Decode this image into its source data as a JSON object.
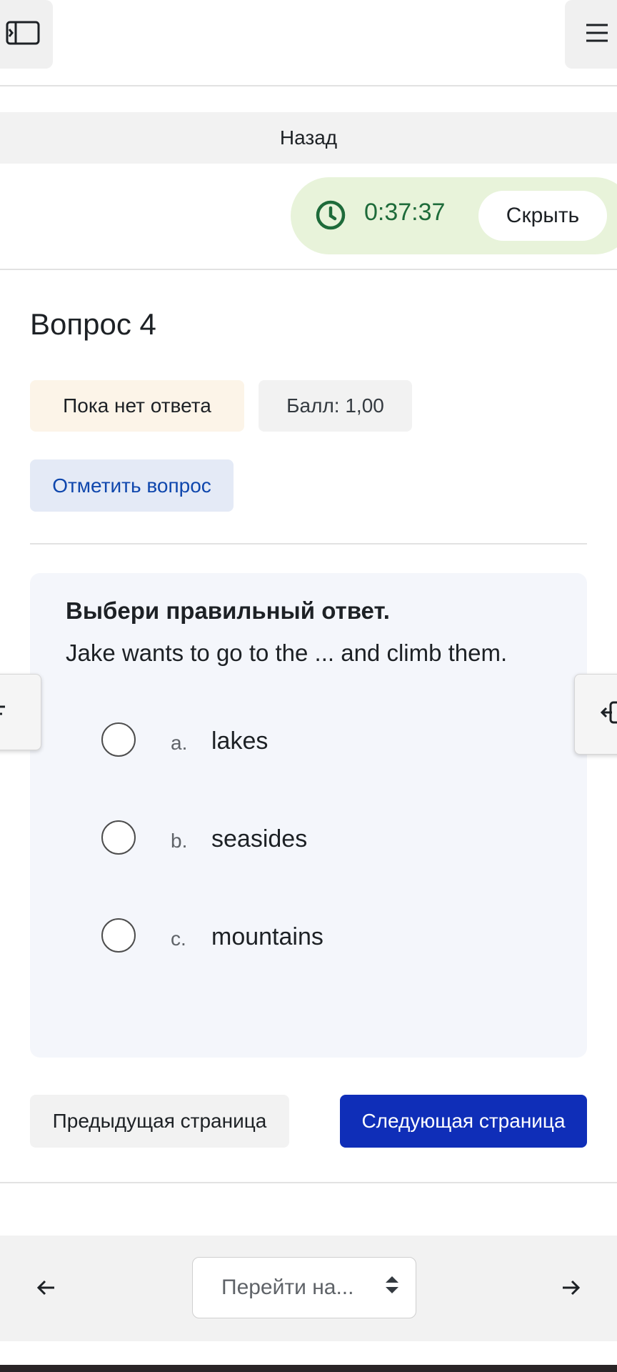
{
  "nav": {
    "back_label": "Назад"
  },
  "timer": {
    "value": "0:37:37",
    "hide_label": "Скрыть"
  },
  "question": {
    "title": "Вопрос 4",
    "status": "Пока нет ответа",
    "points": "Балл: 1,00",
    "flag_label": "Отметить вопрос",
    "instruction": "Выбери правильный ответ.",
    "text": "Jake wants to go to the ... and climb them.",
    "options": [
      {
        "letter": "a.",
        "text": "lakes"
      },
      {
        "letter": "b.",
        "text": "seasides"
      },
      {
        "letter": "c.",
        "text": "mountains"
      }
    ]
  },
  "pagination": {
    "prev_label": "Предыдущая страница",
    "next_label": "Следующая страница"
  },
  "footer": {
    "jump_placeholder": "Перейти на..."
  },
  "colors": {
    "accent": "#0f2eb8",
    "timer_bg": "#e8f3da",
    "timer_text": "#1e6b3a",
    "status_bg": "#fcf4e8",
    "flag_bg": "#e4eaf6",
    "card_bg": "#f4f6fb"
  },
  "icons": [
    "sidebar-toggle-icon",
    "hamburger-menu-icon",
    "clock-icon",
    "drawer-left-icon",
    "drawer-right-icon",
    "arrow-left-icon",
    "arrow-right-icon",
    "sort-updown-icon"
  ]
}
